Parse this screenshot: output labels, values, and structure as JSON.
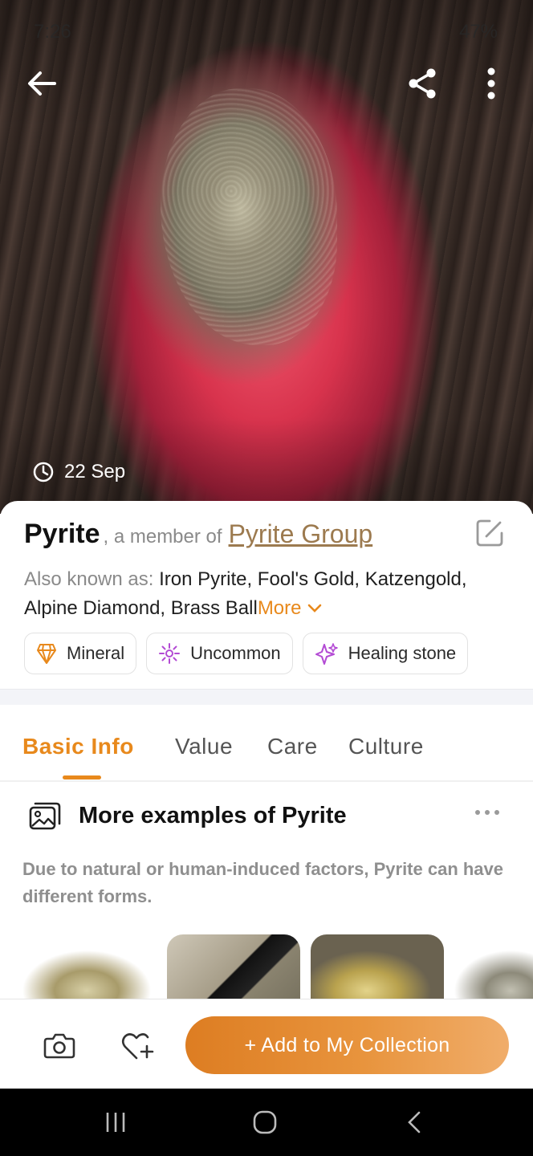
{
  "status_bar": {
    "time": "7:26",
    "battery": "47%"
  },
  "hero": {
    "date": "22 Sep"
  },
  "card": {
    "name": "Pyrite",
    "member_prefix": ", a member of",
    "group": "Pyrite Group",
    "aka_label": "Also known as:",
    "aka_text": "Iron Pyrite, Fool's Gold, Katzengold, Alpine Diamond, Brass Ball",
    "more_label": "More",
    "chips": [
      {
        "label": "Mineral",
        "icon": "mineral-icon",
        "color": "#e8891c"
      },
      {
        "label": "Uncommon",
        "icon": "rarity-sparkle-icon",
        "color": "#b34ad4"
      },
      {
        "label": "Healing stone",
        "icon": "healing-sparkle-icon",
        "color": "#b34ad4"
      }
    ]
  },
  "tabs": [
    {
      "label": "Basic Info",
      "active": true
    },
    {
      "label": "Value",
      "active": false
    },
    {
      "label": "Care",
      "active": false
    },
    {
      "label": "Culture",
      "active": false
    }
  ],
  "section": {
    "title": "More examples of Pyrite",
    "description": "Due to natural or human-induced factors, Pyrite can have different forms."
  },
  "bottom_bar": {
    "add_label": "+ Add to My Collection"
  },
  "colors": {
    "accent": "#e8891c",
    "link": "#9c7a4f",
    "purple": "#b34ad4"
  }
}
